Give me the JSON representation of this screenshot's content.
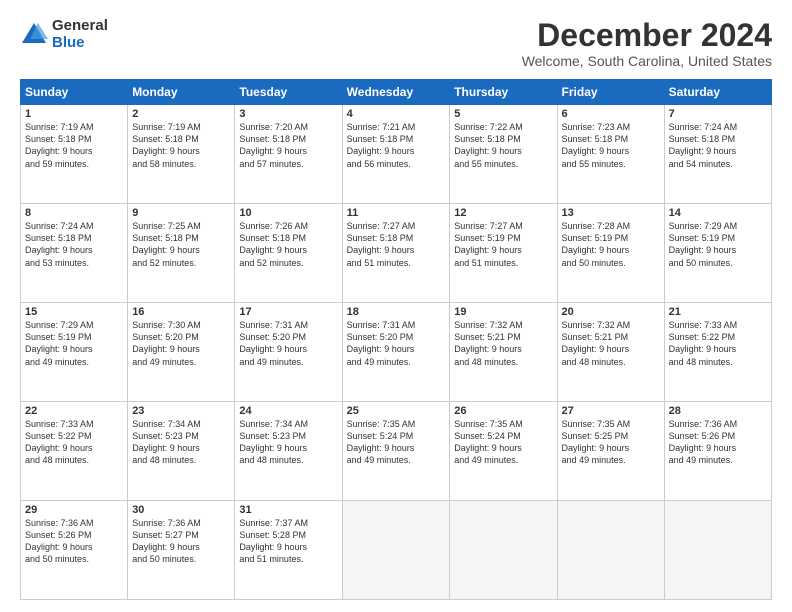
{
  "logo": {
    "general": "General",
    "blue": "Blue"
  },
  "header": {
    "title": "December 2024",
    "subtitle": "Welcome, South Carolina, United States"
  },
  "columns": [
    "Sunday",
    "Monday",
    "Tuesday",
    "Wednesday",
    "Thursday",
    "Friday",
    "Saturday"
  ],
  "weeks": [
    [
      {
        "day": "1",
        "info": "Sunrise: 7:19 AM\nSunset: 5:18 PM\nDaylight: 9 hours\nand 59 minutes."
      },
      {
        "day": "2",
        "info": "Sunrise: 7:19 AM\nSunset: 5:18 PM\nDaylight: 9 hours\nand 58 minutes."
      },
      {
        "day": "3",
        "info": "Sunrise: 7:20 AM\nSunset: 5:18 PM\nDaylight: 9 hours\nand 57 minutes."
      },
      {
        "day": "4",
        "info": "Sunrise: 7:21 AM\nSunset: 5:18 PM\nDaylight: 9 hours\nand 56 minutes."
      },
      {
        "day": "5",
        "info": "Sunrise: 7:22 AM\nSunset: 5:18 PM\nDaylight: 9 hours\nand 55 minutes."
      },
      {
        "day": "6",
        "info": "Sunrise: 7:23 AM\nSunset: 5:18 PM\nDaylight: 9 hours\nand 55 minutes."
      },
      {
        "day": "7",
        "info": "Sunrise: 7:24 AM\nSunset: 5:18 PM\nDaylight: 9 hours\nand 54 minutes."
      }
    ],
    [
      {
        "day": "8",
        "info": "Sunrise: 7:24 AM\nSunset: 5:18 PM\nDaylight: 9 hours\nand 53 minutes."
      },
      {
        "day": "9",
        "info": "Sunrise: 7:25 AM\nSunset: 5:18 PM\nDaylight: 9 hours\nand 52 minutes."
      },
      {
        "day": "10",
        "info": "Sunrise: 7:26 AM\nSunset: 5:18 PM\nDaylight: 9 hours\nand 52 minutes."
      },
      {
        "day": "11",
        "info": "Sunrise: 7:27 AM\nSunset: 5:18 PM\nDaylight: 9 hours\nand 51 minutes."
      },
      {
        "day": "12",
        "info": "Sunrise: 7:27 AM\nSunset: 5:19 PM\nDaylight: 9 hours\nand 51 minutes."
      },
      {
        "day": "13",
        "info": "Sunrise: 7:28 AM\nSunset: 5:19 PM\nDaylight: 9 hours\nand 50 minutes."
      },
      {
        "day": "14",
        "info": "Sunrise: 7:29 AM\nSunset: 5:19 PM\nDaylight: 9 hours\nand 50 minutes."
      }
    ],
    [
      {
        "day": "15",
        "info": "Sunrise: 7:29 AM\nSunset: 5:19 PM\nDaylight: 9 hours\nand 49 minutes."
      },
      {
        "day": "16",
        "info": "Sunrise: 7:30 AM\nSunset: 5:20 PM\nDaylight: 9 hours\nand 49 minutes."
      },
      {
        "day": "17",
        "info": "Sunrise: 7:31 AM\nSunset: 5:20 PM\nDaylight: 9 hours\nand 49 minutes."
      },
      {
        "day": "18",
        "info": "Sunrise: 7:31 AM\nSunset: 5:20 PM\nDaylight: 9 hours\nand 49 minutes."
      },
      {
        "day": "19",
        "info": "Sunrise: 7:32 AM\nSunset: 5:21 PM\nDaylight: 9 hours\nand 48 minutes."
      },
      {
        "day": "20",
        "info": "Sunrise: 7:32 AM\nSunset: 5:21 PM\nDaylight: 9 hours\nand 48 minutes."
      },
      {
        "day": "21",
        "info": "Sunrise: 7:33 AM\nSunset: 5:22 PM\nDaylight: 9 hours\nand 48 minutes."
      }
    ],
    [
      {
        "day": "22",
        "info": "Sunrise: 7:33 AM\nSunset: 5:22 PM\nDaylight: 9 hours\nand 48 minutes."
      },
      {
        "day": "23",
        "info": "Sunrise: 7:34 AM\nSunset: 5:23 PM\nDaylight: 9 hours\nand 48 minutes."
      },
      {
        "day": "24",
        "info": "Sunrise: 7:34 AM\nSunset: 5:23 PM\nDaylight: 9 hours\nand 48 minutes."
      },
      {
        "day": "25",
        "info": "Sunrise: 7:35 AM\nSunset: 5:24 PM\nDaylight: 9 hours\nand 49 minutes."
      },
      {
        "day": "26",
        "info": "Sunrise: 7:35 AM\nSunset: 5:24 PM\nDaylight: 9 hours\nand 49 minutes."
      },
      {
        "day": "27",
        "info": "Sunrise: 7:35 AM\nSunset: 5:25 PM\nDaylight: 9 hours\nand 49 minutes."
      },
      {
        "day": "28",
        "info": "Sunrise: 7:36 AM\nSunset: 5:26 PM\nDaylight: 9 hours\nand 49 minutes."
      }
    ],
    [
      {
        "day": "29",
        "info": "Sunrise: 7:36 AM\nSunset: 5:26 PM\nDaylight: 9 hours\nand 50 minutes."
      },
      {
        "day": "30",
        "info": "Sunrise: 7:36 AM\nSunset: 5:27 PM\nDaylight: 9 hours\nand 50 minutes."
      },
      {
        "day": "31",
        "info": "Sunrise: 7:37 AM\nSunset: 5:28 PM\nDaylight: 9 hours\nand 51 minutes."
      },
      {
        "day": "",
        "info": ""
      },
      {
        "day": "",
        "info": ""
      },
      {
        "day": "",
        "info": ""
      },
      {
        "day": "",
        "info": ""
      }
    ]
  ]
}
